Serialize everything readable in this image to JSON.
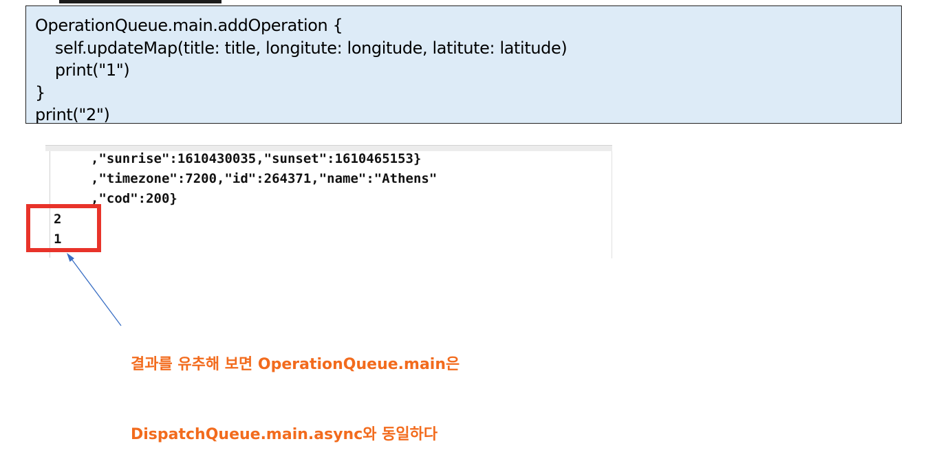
{
  "code_snippet": {
    "lines": [
      "OperationQueue.main.addOperation {",
      "    self.updateMap(title: title, longitute: longitude, latitute: latitude)",
      "    print(\"1\")",
      "}",
      "print(\"2\")"
    ],
    "background_color": "#ddebf7"
  },
  "console_output": {
    "lines": [
      ",\"sunrise\":1610430035,\"sunset\":1610465153}",
      ",\"timezone\":7200,\"id\":264371,\"name\":\"Athens\"",
      ",\"cod\":200}",
      "2",
      "1"
    ]
  },
  "highlight": {
    "color": "#e8332a"
  },
  "arrow": {
    "color": "#3a6fc4"
  },
  "annotation": {
    "line1": "결과를 유추해 보면 OperationQueue.main은",
    "line2": "DispatchQueue.main.async와 동일하다",
    "color": "#f26b1d"
  }
}
